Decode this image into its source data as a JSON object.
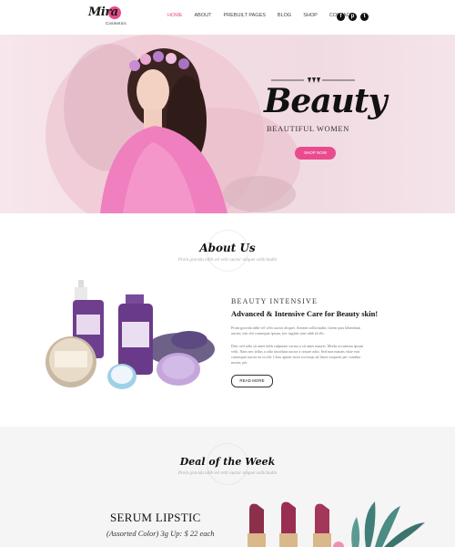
{
  "brand": {
    "name": "Mira",
    "tagline": "Cosmetics",
    "accent": "#e94b8e"
  },
  "nav": {
    "items": [
      {
        "label": "HOME",
        "active": true
      },
      {
        "label": "ABOUT",
        "active": false
      },
      {
        "label": "PREBUILT PAGES",
        "active": false
      },
      {
        "label": "BLOG",
        "active": false
      },
      {
        "label": "SHOP",
        "active": false
      },
      {
        "label": "CONTACT",
        "active": false
      }
    ],
    "social": [
      {
        "icon": "facebook-icon",
        "glyph": "f"
      },
      {
        "icon": "pinterest-icon",
        "glyph": "p"
      },
      {
        "icon": "twitter-icon",
        "glyph": "t"
      }
    ]
  },
  "hero": {
    "title": "Beauty",
    "subtitle": "BEAUTIFUL WOMEN",
    "button": "SHOP NOW"
  },
  "about": {
    "title": "About Us",
    "subtitle": "Proin gravida nibh vel velit auctor aliquet sollicitudin",
    "kicker": "BEAUTY INTENSIVE",
    "heading": "Advanced & Intensive Care for Beauty skin!",
    "para1": "Proin gravida nibh vel velit auctor aliquet. Aenean sollicitudin, lorem quis bibendum auctor, nisi elit consequat ipsum, nec sagittis sem nibh id elit.",
    "para2": "Duis sed odio sit amet nibh vulputate cursus a sit amet mauris. Morbi accumsan ipsum velit. Nam nec tellus a odio tincidunt auctor a ornare odio. Sed non mauris vitae erat consequat auctor eu in elit. Class aptent taciti sociosqu ad litora torquent per conubia nostra, per.",
    "button": "READ MORE"
  },
  "deal": {
    "title": "Deal of the Week",
    "subtitle": "Proin gravida nibh vel velit auctor aliquet sollicitudin",
    "product_name": "SERUM LIPSTIC",
    "product_desc": "(Assorted Color) 3g Up: $ 22 each"
  }
}
